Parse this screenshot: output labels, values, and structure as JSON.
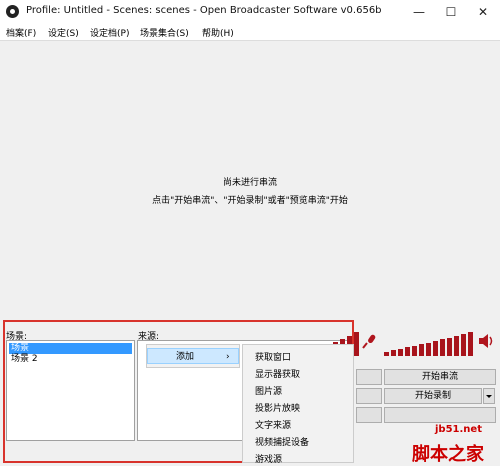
{
  "window": {
    "title": "Profile: Untitled - Scenes: scenes - Open Broadcaster Software v0.656b"
  },
  "menu": [
    "档案(F)",
    "设定(S)",
    "设定档(P)",
    "场景集合(S)",
    "帮助(H)"
  ],
  "preview": {
    "line1": "尚未进行串流",
    "line2": "点击\"开始串流\"、\"开始录制\"或者\"预览串流\"开始"
  },
  "scenes": {
    "label": "场景:",
    "items": [
      "场景",
      "场景 2"
    ],
    "selected_index": 0
  },
  "sources": {
    "label": "来源:"
  },
  "context_menu": {
    "add_label": "添加",
    "arrow": "›"
  },
  "submenu": [
    "获取窗口",
    "显示器获取",
    "图片源",
    "投影片放映",
    "文字来源",
    "视频捕捉设备",
    "游戏源"
  ],
  "controls": {
    "start_stream": "开始串流",
    "start_record": "开始录制"
  },
  "watermark": {
    "line1": "jb51.net",
    "line2": "脚本之家"
  },
  "icons": {
    "app": "obs-logo-icon",
    "mic": "microphone-icon",
    "speaker": "speaker-icon"
  },
  "colors": {
    "highlight_box": "#d8332c",
    "meter": "#a8141c",
    "selection": "#3399ff"
  }
}
